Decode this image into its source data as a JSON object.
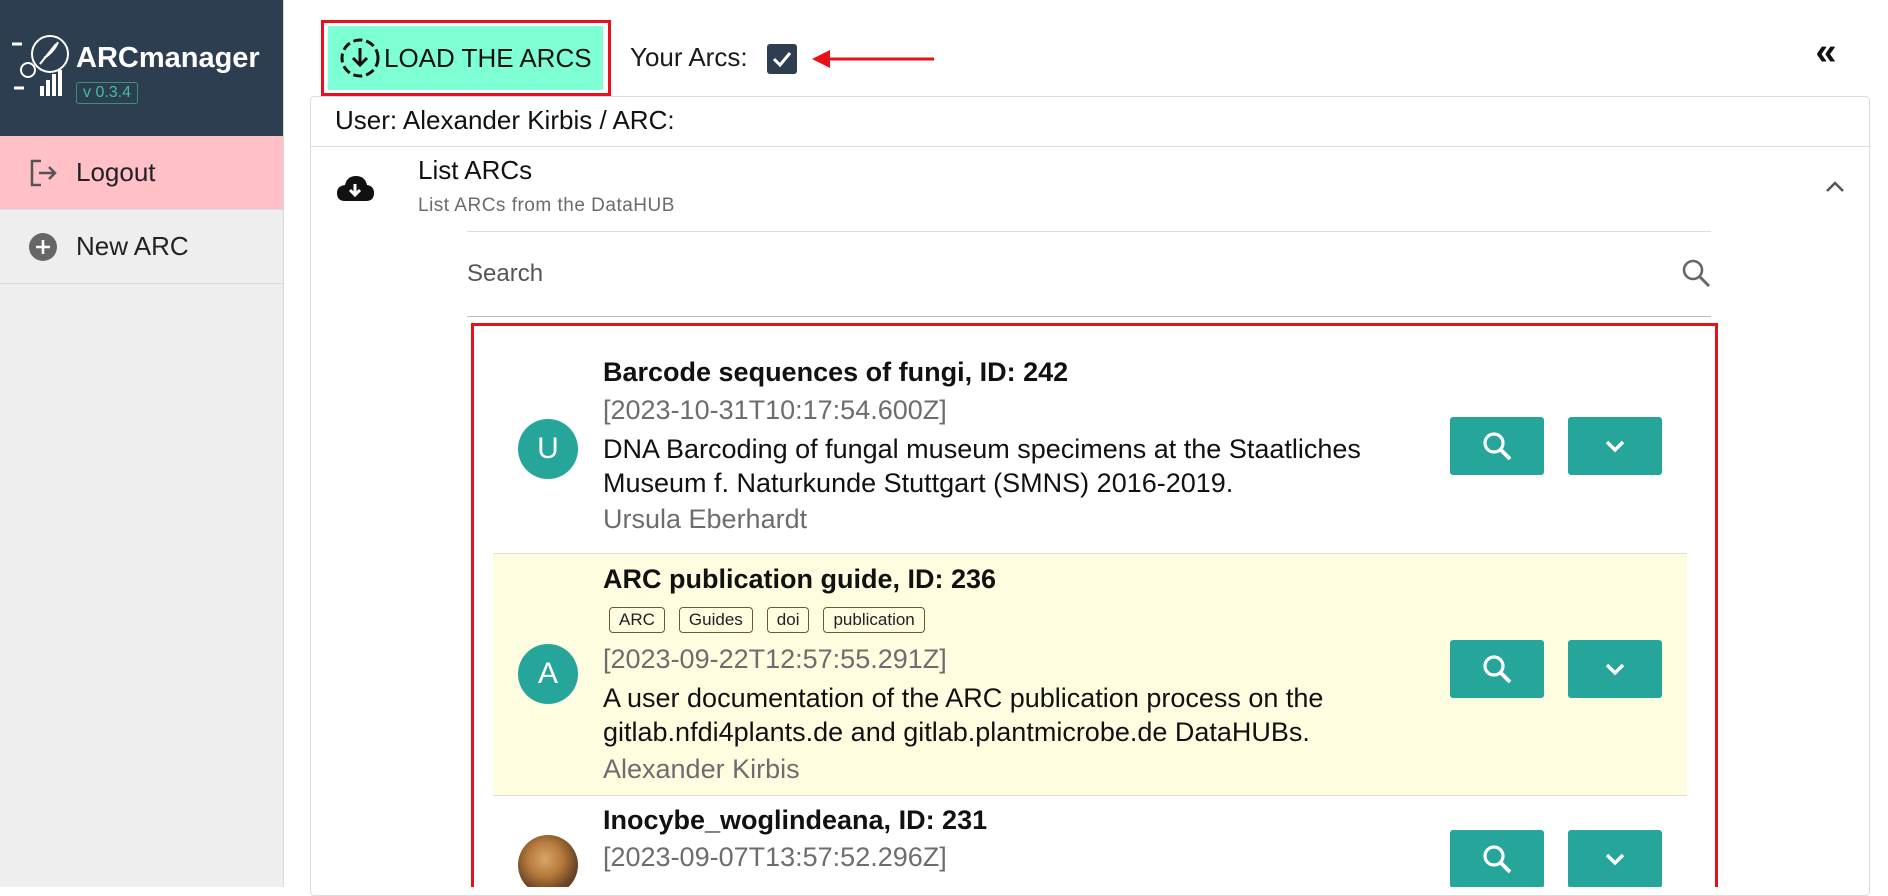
{
  "brand": {
    "name": "ARCmanager",
    "version": "v 0.3.4"
  },
  "sidebar": {
    "items": [
      {
        "label": "Logout",
        "icon": "logout-icon"
      },
      {
        "label": "New ARC",
        "icon": "plus-circle-icon"
      }
    ]
  },
  "toolbar": {
    "load_label": "LOAD THE ARCS",
    "your_arcs_label": "Your Arcs:",
    "your_arcs_checked": true,
    "collapse_glyph": "«"
  },
  "panel": {
    "user_line": "User: Alexander Kirbis / ARC:",
    "section_title": "List ARCs",
    "section_subtitle": "List ARCs from the DataHUB"
  },
  "search": {
    "placeholder": "Search",
    "value": ""
  },
  "arcs": [
    {
      "avatar": "U",
      "title": "Barcode sequences of fungi, ID: 242",
      "tags": [],
      "date": "[2023-10-31T10:17:54.600Z]",
      "description": "DNA Barcoding of fungal museum specimens at the Staatliches Museum f. Naturkunde Stuttgart (SMNS) 2016-2019.",
      "author": "Ursula Eberhardt"
    },
    {
      "avatar": "A",
      "title": "ARC publication guide, ID: 236",
      "tags": [
        "ARC",
        "Guides",
        "doi",
        "publication"
      ],
      "date": "[2023-09-22T12:57:55.291Z]",
      "description": "A user documentation of the ARC publication process on the gitlab.nfdi4plants.de and gitlab.plantmicrobe.de DataHUBs.",
      "author": "Alexander Kirbis"
    },
    {
      "avatar": "",
      "title": "Inocybe_woglindeana, ID: 231",
      "tags": [],
      "date": "[2023-09-07T13:57:52.296Z]",
      "description": "",
      "author": ""
    }
  ],
  "colors": {
    "sidebar_header": "#2d3e50",
    "accent": "#26a69a",
    "load_button": "#7fffd4",
    "logout_bg": "#ffc0c8",
    "highlight_row": "#fffde0",
    "annotation_red": "#e8101a"
  }
}
